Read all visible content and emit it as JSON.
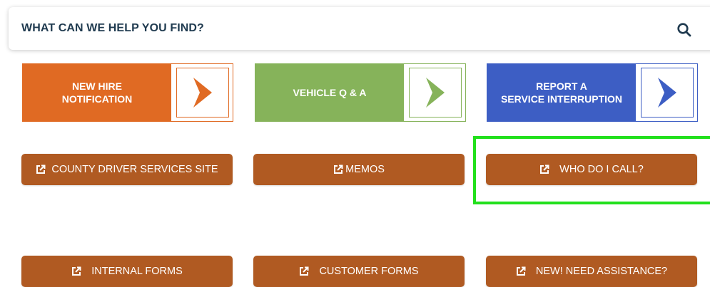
{
  "search": {
    "prompt": "WHAT CAN WE HELP YOU FIND?",
    "icon": "search-icon"
  },
  "promos": [
    {
      "label": "NEW HIRE\nNOTIFICATION",
      "color": "#e06a23"
    },
    {
      "label": "VEHICLE Q & A",
      "color": "#86b35a"
    },
    {
      "label": "REPORT A\nSERVICE INTERRUPTION",
      "color": "#3d5ec4"
    }
  ],
  "links": [
    {
      "label": "COUNTY DRIVER SERVICES SITE"
    },
    {
      "label": "MEMOS"
    },
    {
      "label": "WHO DO I CALL?"
    },
    {
      "label": "INTERNAL FORMS"
    },
    {
      "label": "CUSTOMER FORMS"
    },
    {
      "label": "NEW! NEED ASSISTANCE?"
    }
  ],
  "colors": {
    "link_button": "#b05a22",
    "highlight": "#22e01c",
    "heading": "#1f3a4f"
  }
}
